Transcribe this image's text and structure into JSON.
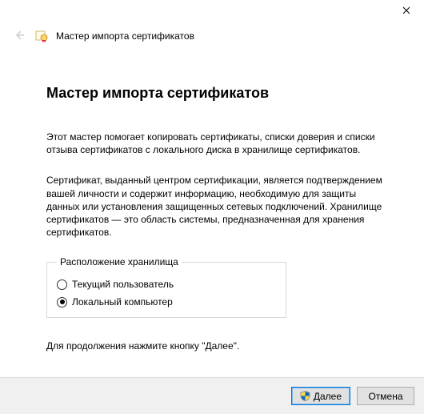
{
  "window": {
    "header_title": "Мастер импорта сертификатов"
  },
  "page": {
    "heading": "Мастер импорта сертификатов",
    "intro": "Этот мастер помогает копировать сертификаты, списки доверия и списки отзыва сертификатов с локального диска в хранилище сертификатов.",
    "description": "Сертификат, выданный центром сертификации, является подтверждением вашей личности и содержит информацию, необходимую для защиты данных или установления защищенных сетевых подключений. Хранилище сертификатов — это область системы, предназначенная для хранения сертификатов.",
    "storage_location": {
      "legend": "Расположение хранилища",
      "options": [
        {
          "label": "Текущий пользователь",
          "selected": false
        },
        {
          "label": "Локальный компьютер",
          "selected": true
        }
      ]
    },
    "continue_note": "Для продолжения нажмите кнопку \"Далее\"."
  },
  "footer": {
    "next_label": "Далее",
    "cancel_label": "Отмена"
  }
}
